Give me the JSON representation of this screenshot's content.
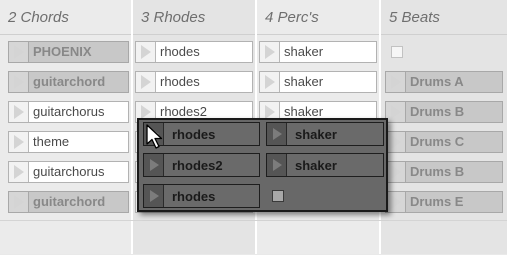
{
  "tracks": [
    {
      "title": "2 Chords",
      "clips": [
        "PHOENIX",
        "guitarchord",
        "guitarchorus",
        "theme",
        "guitarchorus",
        "guitarchord"
      ]
    },
    {
      "title": "3 Rhodes",
      "clips": [
        "rhodes",
        "rhodes",
        "rhodes2",
        "",
        "",
        ""
      ]
    },
    {
      "title": "4 Perc's",
      "clips": [
        "shaker",
        "shaker",
        "shaker",
        "",
        "",
        ""
      ]
    },
    {
      "title": "5 Beats",
      "clips": [
        "",
        "Drums A",
        "Drums B",
        "Drums C",
        "Drums B",
        "Drums E"
      ]
    }
  ],
  "dragged_clips": {
    "col1": [
      "rhodes",
      "rhodes2",
      "rhodes"
    ],
    "col2": [
      "shaker",
      "shaker",
      ""
    ]
  },
  "colors": {
    "background": "#ebebeb",
    "clip_gray": "#c8c8c8",
    "drag_background": "#686868"
  }
}
